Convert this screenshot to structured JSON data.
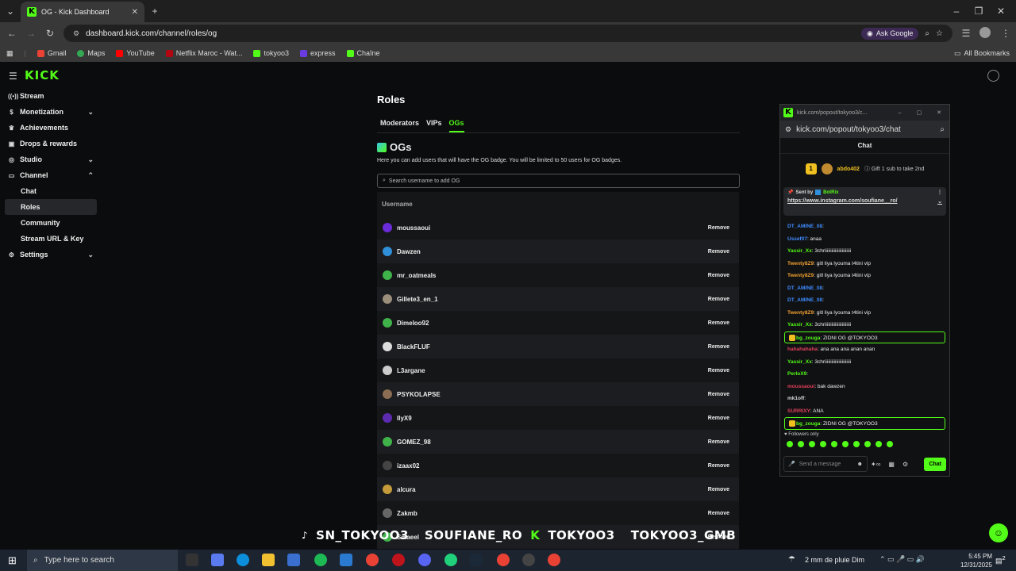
{
  "browser": {
    "tab_title": "OG - Kick Dashboard",
    "url": "dashboard.kick.com/channel/roles/og",
    "ask_google": "Ask Google",
    "bookmarks": [
      "Gmail",
      "Maps",
      "YouTube",
      "Netflix Maroc - Wat...",
      "tokyoo3",
      "express",
      "Chaîne"
    ],
    "all_bookmarks": "All Bookmarks"
  },
  "sidebar": {
    "logo": "KICK",
    "items": [
      {
        "label": "Stream",
        "icon": "stream-icon"
      },
      {
        "label": "Monetization",
        "icon": "dollar-icon",
        "chevron": "down"
      },
      {
        "label": "Achievements",
        "icon": "trophy-icon"
      },
      {
        "label": "Drops & rewards",
        "icon": "gift-icon"
      },
      {
        "label": "Studio",
        "icon": "studio-icon",
        "chevron": "down"
      },
      {
        "label": "Channel",
        "icon": "channel-icon",
        "chevron": "up"
      }
    ],
    "channel_sub": [
      "Chat",
      "Roles",
      "Community",
      "Stream URL & Key"
    ],
    "settings": "Settings",
    "active": "Roles"
  },
  "main": {
    "title": "Roles",
    "tabs": [
      "Moderators",
      "VIPs",
      "OGs"
    ],
    "active_tab": "OGs",
    "og_title": "OGs",
    "og_desc": "Here you can add users that will have the OG badge. You will be limited to 50 users for OG badges.",
    "search_placeholder": "Search username to add OG",
    "col_username": "Username",
    "remove_label": "Remove",
    "users": [
      {
        "name": "moussaoui",
        "color": "#6a2bd8"
      },
      {
        "name": "Dawzen",
        "color": "#2f8fd8"
      },
      {
        "name": "mr_oatmeals",
        "color": "#3fb34a"
      },
      {
        "name": "Gillete3_en_1",
        "color": "#9b8f7c"
      },
      {
        "name": "Dimeloo92",
        "color": "#3fb34a"
      },
      {
        "name": "BlackFLUF",
        "color": "#dddddd"
      },
      {
        "name": "L3argane",
        "color": "#cccccc"
      },
      {
        "name": "PSYKOLAPSE",
        "color": "#8a6d52"
      },
      {
        "name": "IlyX9",
        "color": "#5d2bb0"
      },
      {
        "name": "GOMEZ_98",
        "color": "#3fb34a"
      },
      {
        "name": "izaax02",
        "color": "#444444"
      },
      {
        "name": "alcura",
        "color": "#c49a3a"
      },
      {
        "name": "Zakmb",
        "color": "#666666"
      },
      {
        "name": "Smaeel",
        "color": "#3fb34a"
      }
    ]
  },
  "popout": {
    "window_title": "kick.com/popout/tokyoo3/c...",
    "url": "kick.com/popout/tokyoo3/chat",
    "chat_title": "Chat",
    "gift_user": "abdo402",
    "gift_count": "1",
    "gift_text": "Gift 1 sub to take 2nd",
    "pinned_sent_by": "Sent by",
    "pinned_bot": "BotRix",
    "pinned_link": "https://www.instagram.com/soufiane__ro/",
    "messages": [
      {
        "user": "DT_AMINE_08",
        "color": "#3f8cff",
        "text": ":"
      },
      {
        "user": "Ussef07",
        "color": "#3f8cff",
        "text": ": anaa"
      },
      {
        "user": "Yassir_Xx",
        "color": "#53fc18",
        "text": ": 3chriiiiiiiiiiiiiiiiiiiiiii"
      },
      {
        "user": "Twenty8Z9",
        "color": "#f0a030",
        "text": ": gitl liya lyouma t4tini vip"
      },
      {
        "user": "Twenty8Z9",
        "color": "#f0a030",
        "text": ": gitl liya lyouma t4tini vip"
      },
      {
        "user": "DT_AMINE_08",
        "color": "#3f8cff",
        "text": ":"
      },
      {
        "user": "DT_AMINE_08",
        "color": "#3f8cff",
        "text": ":"
      },
      {
        "user": "Twenty8Z9",
        "color": "#f0a030",
        "text": ": gitl liya lyouma t4tini vip"
      },
      {
        "user": "Yassir_Xx",
        "color": "#53fc18",
        "text": ": 3chriiiiiiiiiiiiiiiiiiiiiii"
      },
      {
        "user": "bg_zouga",
        "color": "#53fc18",
        "text": ": ZIDNI OG @TOKYOO3",
        "box": true
      },
      {
        "user": "hahahahaha",
        "color": "#e0405a",
        "text": ": ana ana ana anan anan"
      },
      {
        "user": "Yassir_Xx",
        "color": "#53fc18",
        "text": ": 3chriiiiiiiiiiiiiiiiiiiiiii"
      },
      {
        "user": "PerloX9",
        "color": "#53fc18",
        "text": ":"
      },
      {
        "user": "moussaoui",
        "color": "#e0405a",
        "text": ": bak dawzen"
      },
      {
        "user": "mk1off",
        "color": "#dddddd",
        "text": ":"
      },
      {
        "user": "SURRIXY",
        "color": "#e0405a",
        "text": ": ANA"
      },
      {
        "user": "bg_zouga",
        "color": "#53fc18",
        "text": ": ZIDNI OG @TOKYOO3",
        "box": true
      }
    ],
    "followers_only": "Followers only",
    "send_placeholder": "Send a message",
    "chat_button": "Chat"
  },
  "overlay": {
    "handles": [
      "SN_TOKYOO3",
      "SOUFIANE_RO",
      "TOKYOO3",
      "TOKYOO3_GMB"
    ]
  },
  "taskbar": {
    "search_placeholder": "Type here to search",
    "weather": "2 mm de pluie Dim",
    "time": "5:45 PM",
    "date": "12/31/2025",
    "notifications": "2"
  }
}
